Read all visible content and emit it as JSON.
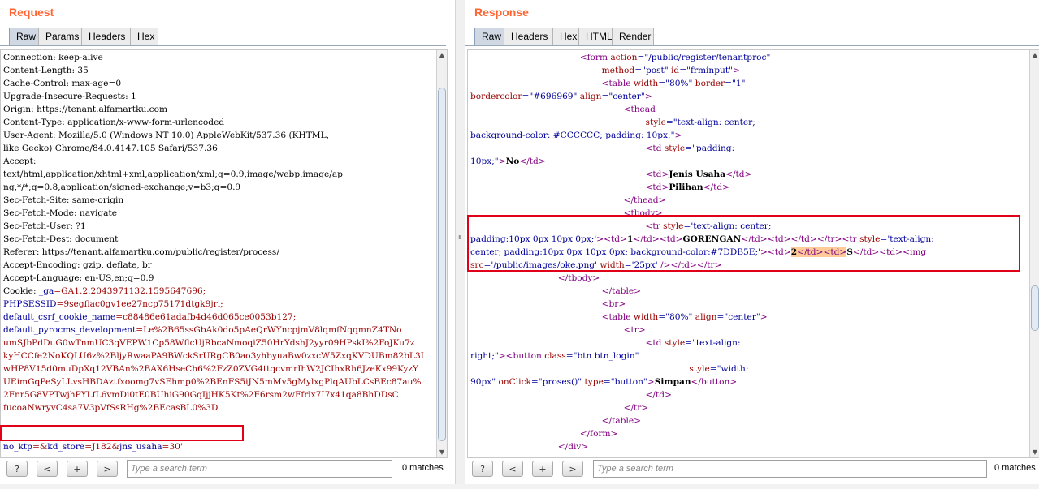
{
  "request": {
    "title": "Request",
    "tabs": [
      "Raw",
      "Params",
      "Headers",
      "Hex"
    ],
    "active_tab": "Raw",
    "lines": [
      [
        {
          "t": "Connection: keep-alive",
          "c": ""
        }
      ],
      [
        {
          "t": "Content-Length: 35",
          "c": ""
        }
      ],
      [
        {
          "t": "Cache-Control: max-age=0",
          "c": ""
        }
      ],
      [
        {
          "t": "Upgrade-Insecure-Requests: 1",
          "c": ""
        }
      ],
      [
        {
          "t": "Origin: https://tenant.alfamartku.com",
          "c": ""
        }
      ],
      [
        {
          "t": "Content-Type: application/x-www-form-urlencoded",
          "c": ""
        }
      ],
      [
        {
          "t": "User-Agent: Mozilla/5.0 (Windows NT 10.0) AppleWebKit/537.36 (KHTML,",
          "c": ""
        }
      ],
      [
        {
          "t": "like Gecko) Chrome/84.0.4147.105 Safari/537.36",
          "c": ""
        }
      ],
      [
        {
          "t": "Accept:",
          "c": ""
        }
      ],
      [
        {
          "t": "text/html,application/xhtml+xml,application/xml;q=0.9,image/webp,image/ap",
          "c": ""
        }
      ],
      [
        {
          "t": "ng,*/*;q=0.8,application/signed-exchange;v=b3;q=0.9",
          "c": ""
        }
      ],
      [
        {
          "t": "Sec-Fetch-Site: same-origin",
          "c": ""
        }
      ],
      [
        {
          "t": "Sec-Fetch-Mode: navigate",
          "c": ""
        }
      ],
      [
        {
          "t": "Sec-Fetch-User: ?1",
          "c": ""
        }
      ],
      [
        {
          "t": "Sec-Fetch-Dest: document",
          "c": ""
        }
      ],
      [
        {
          "t": "Referer: https://tenant.alfamartku.com/public/register/process/",
          "c": ""
        }
      ],
      [
        {
          "t": "Accept-Encoding: gzip, deflate, br",
          "c": ""
        }
      ],
      [
        {
          "t": "Accept-Language: en-US,en;q=0.9",
          "c": ""
        }
      ],
      [
        {
          "t": "Cookie: ",
          "c": ""
        },
        {
          "t": "_ga",
          "c": "blue"
        },
        {
          "t": "=GA1.2.2043971132.1595647696;",
          "c": "red"
        }
      ],
      [
        {
          "t": "PHPSESSID",
          "c": "blue"
        },
        {
          "t": "=9segfiac0gv1ee27ncp75171dtgk9jri;",
          "c": "red"
        }
      ],
      [
        {
          "t": "default_csrf_cookie_name",
          "c": "blue"
        },
        {
          "t": "=c88486e61adafb4d46d065ce0053b127;",
          "c": "red"
        }
      ],
      [
        {
          "t": "default_pyrocms_development",
          "c": "blue"
        },
        {
          "t": "=Le%2B65ssGbAk0do5pAeQrWYncpjmV8lqmfNqqmnZ4TNo",
          "c": "red"
        }
      ],
      [
        {
          "t": "umSJbPdDuG0wTnmUC3qVEPW1Cp58WflcUjRbcaNmoqiZ50HrYdshJ2yyr09HPskI%2FoJKu7z",
          "c": "red"
        }
      ],
      [
        {
          "t": "kyHCCfe2NoKQLU6z%2BljyRwaaPA9BWckSrURgCB0ao3yhbyuaBw0zxcW5ZxqKVDUBm82bL3I",
          "c": "red"
        }
      ],
      [
        {
          "t": "wHP8V15d0muDpXq12VBAn%2BAX6HseCh6%2FzZ0ZVG4ttqcvmrIhW2JCIhxRh6JzeKx99KyzY",
          "c": "red"
        }
      ],
      [
        {
          "t": "UEimGqPeSyLLvsHBDAztfxoomg7vSEhmp0%2BEnFS5iJN5mMv5gMylxgPlqAUbLCsBEc87au%",
          "c": "red"
        }
      ],
      [
        {
          "t": "2Fnr5G8VPTwjhPYLfL6vmDi0tE0BUhiG90GqIjjHK5Kt%2F6rsm2wFfrlx7I7x41qa8BhDDsC",
          "c": "red"
        }
      ],
      [
        {
          "t": "fucoaNwryvC4sa7V3pVfSsRHg%2BEcasBL0%3D",
          "c": "red"
        }
      ],
      [
        {
          "t": "",
          "c": ""
        }
      ],
      [
        {
          "t": "",
          "c": ""
        }
      ],
      [
        {
          "t": "no_ktp",
          "c": "blue"
        },
        {
          "t": "=&",
          "c": "red"
        },
        {
          "t": "kd_store",
          "c": "blue"
        },
        {
          "t": "=J182&",
          "c": "red"
        },
        {
          "t": "jns_usaha",
          "c": "blue"
        },
        {
          "t": "=30'",
          "c": "red"
        }
      ]
    ],
    "search": {
      "placeholder": "Type a search term",
      "matches": "0 matches"
    }
  },
  "response": {
    "title": "Response",
    "tabs": [
      "Raw",
      "Headers",
      "Hex",
      "HTML",
      "Render"
    ],
    "active_tab": "Raw",
    "lines": [
      [
        {
          "t": "                                        ",
          "c": ""
        },
        {
          "t": "<form ",
          "c": "tag"
        },
        {
          "t": "action",
          "c": "attr"
        },
        {
          "t": "=\"/public/register/tenantproc\"",
          "c": "val"
        }
      ],
      [
        {
          "t": "                                                ",
          "c": ""
        },
        {
          "t": "method",
          "c": "attr"
        },
        {
          "t": "=\"post\" ",
          "c": "val"
        },
        {
          "t": "id",
          "c": "attr"
        },
        {
          "t": "=\"frminput\"",
          "c": "val"
        },
        {
          "t": ">",
          "c": "tag"
        }
      ],
      [
        {
          "t": "                                                ",
          "c": ""
        },
        {
          "t": "<table ",
          "c": "tag"
        },
        {
          "t": "width",
          "c": "attr"
        },
        {
          "t": "=\"80%\" ",
          "c": "val"
        },
        {
          "t": "border",
          "c": "attr"
        },
        {
          "t": "=\"1\"",
          "c": "val"
        }
      ],
      [
        {
          "t": "bordercolor",
          "c": "attr"
        },
        {
          "t": "=\"#696969\" ",
          "c": "val"
        },
        {
          "t": "align",
          "c": "attr"
        },
        {
          "t": "=\"center\"",
          "c": "val"
        },
        {
          "t": ">",
          "c": "tag"
        }
      ],
      [
        {
          "t": "                                                        ",
          "c": ""
        },
        {
          "t": "<thead",
          "c": "tag"
        }
      ],
      [
        {
          "t": "                                                                ",
          "c": ""
        },
        {
          "t": "style",
          "c": "attr"
        },
        {
          "t": "=\"text-align: center;",
          "c": "val"
        }
      ],
      [
        {
          "t": "background-color: #CCCCCC; padding: 10px;\"",
          "c": "val"
        },
        {
          "t": ">",
          "c": "tag"
        }
      ],
      [
        {
          "t": "                                                                ",
          "c": ""
        },
        {
          "t": "<td ",
          "c": "tag"
        },
        {
          "t": "style",
          "c": "attr"
        },
        {
          "t": "=\"padding:",
          "c": "val"
        }
      ],
      [
        {
          "t": "10px;\"",
          "c": "val"
        },
        {
          "t": ">",
          "c": "tag"
        },
        {
          "t": "No",
          "c": "bold"
        },
        {
          "t": "</td>",
          "c": "tag"
        }
      ],
      [
        {
          "t": "                                                                ",
          "c": ""
        },
        {
          "t": "<td>",
          "c": "tag"
        },
        {
          "t": "Jenis Usaha",
          "c": "bold"
        },
        {
          "t": "</td>",
          "c": "tag"
        }
      ],
      [
        {
          "t": "                                                                ",
          "c": ""
        },
        {
          "t": "<td>",
          "c": "tag"
        },
        {
          "t": "Pilihan",
          "c": "bold"
        },
        {
          "t": "</td>",
          "c": "tag"
        }
      ],
      [
        {
          "t": "                                                        ",
          "c": ""
        },
        {
          "t": "</thead>",
          "c": "tag"
        }
      ],
      [
        {
          "t": "                                                        ",
          "c": ""
        },
        {
          "t": "<tbody>",
          "c": "tag"
        }
      ],
      [
        {
          "t": "                                                                ",
          "c": ""
        },
        {
          "t": "<tr ",
          "c": "tag"
        },
        {
          "t": "style",
          "c": "attr"
        },
        {
          "t": "='text-align: center;",
          "c": "val"
        }
      ],
      [
        {
          "t": "padding:10px 0px 10px 0px;'",
          "c": "val"
        },
        {
          "t": ">",
          "c": "tag"
        },
        {
          "t": "<td>",
          "c": "tag"
        },
        {
          "t": "1",
          "c": "bold"
        },
        {
          "t": "</td>",
          "c": "tag"
        },
        {
          "t": "<td>",
          "c": "tag"
        },
        {
          "t": "GORENGAN",
          "c": "bold"
        },
        {
          "t": "</td>",
          "c": "tag"
        },
        {
          "t": "<td>",
          "c": "tag"
        },
        {
          "t": "</td>",
          "c": "tag"
        },
        {
          "t": "</tr>",
          "c": "tag"
        },
        {
          "t": "<tr ",
          "c": "tag"
        },
        {
          "t": "style",
          "c": "attr"
        },
        {
          "t": "='text-align:",
          "c": "val"
        }
      ],
      [
        {
          "t": "center; padding:10px 0px 10px 0px; background-color:#7DDB5E;'",
          "c": "val"
        },
        {
          "t": ">",
          "c": "tag"
        },
        {
          "t": "<td>",
          "c": "tag"
        },
        {
          "t": "2",
          "c": "bold hl"
        },
        {
          "t": "</td><td>",
          "c": "tag hl"
        },
        {
          "t": "S",
          "c": "bold"
        },
        {
          "t": "</td>",
          "c": "tag"
        },
        {
          "t": "<td>",
          "c": "tag"
        },
        {
          "t": "<img",
          "c": "tag"
        }
      ],
      [
        {
          "t": "src",
          "c": "attr"
        },
        {
          "t": "='/public/images/oke.png' ",
          "c": "val"
        },
        {
          "t": "width",
          "c": "attr"
        },
        {
          "t": "='25px' ",
          "c": "val"
        },
        {
          "t": "/>",
          "c": "tag"
        },
        {
          "t": "</td>",
          "c": "tag"
        },
        {
          "t": "</tr>",
          "c": "tag"
        }
      ],
      [
        {
          "t": "                                ",
          "c": ""
        },
        {
          "t": "</tbody>",
          "c": "tag"
        }
      ],
      [
        {
          "t": "                                                ",
          "c": ""
        },
        {
          "t": "</table>",
          "c": "tag"
        }
      ],
      [
        {
          "t": "                                                ",
          "c": ""
        },
        {
          "t": "<br>",
          "c": "tag"
        }
      ],
      [
        {
          "t": "                                                ",
          "c": ""
        },
        {
          "t": "<table ",
          "c": "tag"
        },
        {
          "t": "width",
          "c": "attr"
        },
        {
          "t": "=\"80%\" ",
          "c": "val"
        },
        {
          "t": "align",
          "c": "attr"
        },
        {
          "t": "=\"center\"",
          "c": "val"
        },
        {
          "t": ">",
          "c": "tag"
        }
      ],
      [
        {
          "t": "                                                        ",
          "c": ""
        },
        {
          "t": "<tr>",
          "c": "tag"
        }
      ],
      [
        {
          "t": "                                                                ",
          "c": ""
        },
        {
          "t": "<td ",
          "c": "tag"
        },
        {
          "t": "style",
          "c": "attr"
        },
        {
          "t": "=\"text-align:",
          "c": "val"
        }
      ],
      [
        {
          "t": "right;\"",
          "c": "val"
        },
        {
          "t": ">",
          "c": "tag"
        },
        {
          "t": "<button ",
          "c": "tag"
        },
        {
          "t": "class",
          "c": "attr"
        },
        {
          "t": "=\"btn btn_login\"",
          "c": "val"
        }
      ],
      [
        {
          "t": "                                                                                ",
          "c": ""
        },
        {
          "t": "style",
          "c": "attr"
        },
        {
          "t": "=\"width:",
          "c": "val"
        }
      ],
      [
        {
          "t": "90px\" ",
          "c": "val"
        },
        {
          "t": "onClick",
          "c": "attr"
        },
        {
          "t": "=\"proses()\" ",
          "c": "val"
        },
        {
          "t": "type",
          "c": "attr"
        },
        {
          "t": "=\"button\"",
          "c": "val"
        },
        {
          "t": ">",
          "c": "tag"
        },
        {
          "t": "Simpan",
          "c": "bold"
        },
        {
          "t": "</button>",
          "c": "tag"
        }
      ],
      [
        {
          "t": "                                                                ",
          "c": ""
        },
        {
          "t": "</td>",
          "c": "tag"
        }
      ],
      [
        {
          "t": "                                                        ",
          "c": ""
        },
        {
          "t": "</tr>",
          "c": "tag"
        }
      ],
      [
        {
          "t": "                                                ",
          "c": ""
        },
        {
          "t": "</table>",
          "c": "tag"
        }
      ],
      [
        {
          "t": "                                        ",
          "c": ""
        },
        {
          "t": "</form>",
          "c": "tag"
        }
      ],
      [
        {
          "t": "                                ",
          "c": ""
        },
        {
          "t": "</div>",
          "c": "tag"
        }
      ]
    ],
    "search": {
      "placeholder": "Type a search term",
      "matches": "0 matches"
    }
  },
  "search_buttons": {
    "help": "?",
    "prev": "<",
    "next_plus": "+",
    "next": ">"
  },
  "divider_grip": "ⅱ",
  "scroll_arrows": {
    "up": "▲",
    "down": "▼"
  },
  "colors": {
    "title": "#ff6633",
    "highlight_box": "#e0001a",
    "param_name": "#000099",
    "param_value": "#990000",
    "tag": "#800080"
  }
}
